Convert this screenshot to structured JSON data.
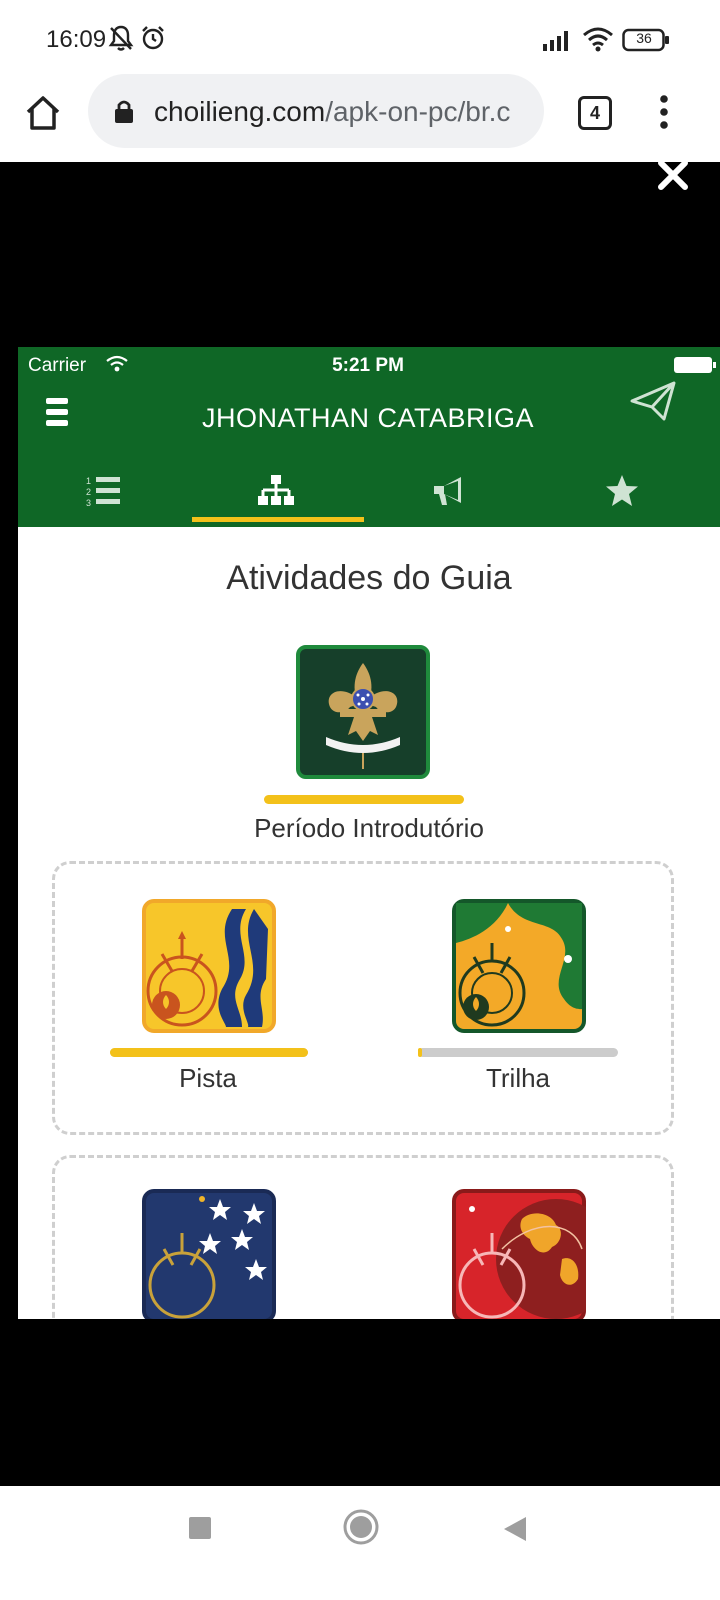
{
  "status_bar": {
    "time": "16:09",
    "battery": "36",
    "icons": [
      "bell-off-icon",
      "alarm-icon",
      "signal-icon",
      "wifi-icon",
      "battery-icon"
    ]
  },
  "browser": {
    "url_host": "choilieng.com",
    "url_path": "/apk-on-pc/br.c",
    "tab_count": "4",
    "icons": [
      "home-icon",
      "lock-icon",
      "more-vert-icon"
    ]
  },
  "overlay": {
    "close_icon": "close-icon"
  },
  "app": {
    "ios_status": {
      "carrier": "Carrier",
      "time": "5:21 PM"
    },
    "header_title": "JHONATHAN CATABRIGA",
    "tabs": [
      {
        "icon": "numbered-list-icon",
        "active": false
      },
      {
        "icon": "hierarchy-icon",
        "active": true
      },
      {
        "icon": "megaphone-icon",
        "active": false
      },
      {
        "icon": "star-icon",
        "active": false
      }
    ],
    "section_title": "Atividades do Guia",
    "intro": {
      "label": "Período Introdutório",
      "progress": 1.0
    },
    "groups": [
      {
        "items": [
          {
            "label": "Pista",
            "progress": 1.0,
            "badge": "pista-badge"
          },
          {
            "label": "Trilha",
            "progress": 0.02,
            "badge": "trilha-badge"
          }
        ]
      },
      {
        "items": [
          {
            "label": "",
            "badge": "stars-badge"
          },
          {
            "label": "",
            "badge": "globe-badge"
          }
        ]
      }
    ],
    "colors": {
      "header_green": "#0f6726",
      "accent_yellow": "#f3c11a",
      "progress_track": "#cccccc"
    }
  },
  "nav_bar": {
    "icons": [
      "recent-apps-icon",
      "home-circle-icon",
      "back-icon"
    ]
  }
}
